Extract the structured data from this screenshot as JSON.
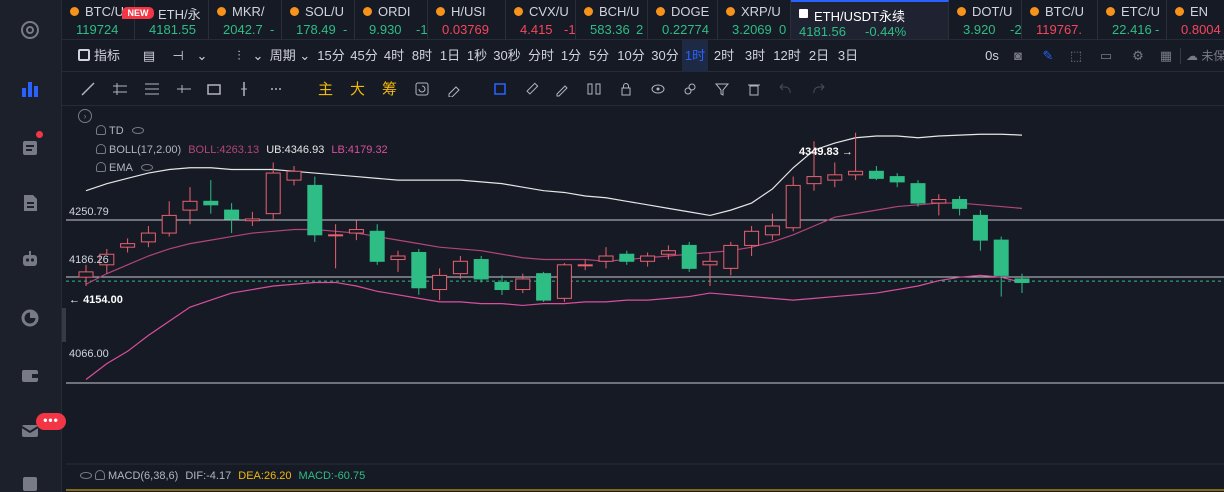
{
  "tickers": [
    {
      "name": "BTC/U",
      "price": "119724",
      "change": "",
      "dir": "up",
      "icon": "btc-coin-icon",
      "active": false
    },
    {
      "name": "ETH/永",
      "price": "4181.55",
      "change": "",
      "dir": "up",
      "icon": "eth-coin-icon",
      "active": false
    },
    {
      "name": "MKR/",
      "price": "2042.7",
      "change": "-",
      "dir": "up",
      "icon": "mkr-coin-icon",
      "active": false
    },
    {
      "name": "SOL/U",
      "price": "178.49",
      "change": "-",
      "dir": "up",
      "icon": "sol-coin-icon",
      "active": false
    },
    {
      "name": "ORDI",
      "price": "9.930",
      "change": "-1",
      "dir": "up",
      "icon": "ordi-coin-icon",
      "active": false
    },
    {
      "name": "H/USI",
      "price": "0.03769",
      "change": "",
      "dir": "down",
      "icon": "h-coin-icon",
      "active": false
    },
    {
      "name": "CVX/U",
      "price": "4.415",
      "change": "-1",
      "dir": "down",
      "icon": "cvx-coin-icon",
      "active": false
    },
    {
      "name": "BCH/U",
      "price": "583.36",
      "change": "2",
      "dir": "up",
      "icon": "bch-coin-icon",
      "active": false
    },
    {
      "name": "DOGE",
      "price": "0.22774",
      "change": "",
      "dir": "up",
      "icon": "doge-coin-icon",
      "active": false
    },
    {
      "name": "XRP/U",
      "price": "3.2069",
      "change": "0",
      "dir": "up",
      "icon": "xrp-coin-icon",
      "active": false
    },
    {
      "name": "ETH/USDT永续",
      "price": "4181.56",
      "change": "-0.44%",
      "dir": "up",
      "icon": "eth-coin-icon",
      "active": true
    },
    {
      "name": "DOT/U",
      "price": "3.920",
      "change": "-2",
      "dir": "up",
      "icon": "dot-coin-icon",
      "active": false
    },
    {
      "name": "BTC/U",
      "price": "119767.",
      "change": "",
      "dir": "down",
      "icon": "btc-coin-icon",
      "active": false
    },
    {
      "name": "ETC/U",
      "price": "22.416",
      "change": "-",
      "dir": "up",
      "icon": "etc-coin-icon",
      "active": false
    },
    {
      "name": "EN",
      "price": "0.8004",
      "change": "",
      "dir": "down",
      "icon": "en-coin-icon",
      "active": false
    }
  ],
  "new_badge": "NEW",
  "toolbar": {
    "indicators_label": "指标",
    "period_label": "周期",
    "intervals": [
      "15分",
      "45分",
      "4时",
      "8时",
      "1日",
      "1秒",
      "30秒",
      "分时",
      "1分",
      "5分",
      "10分",
      "30分",
      "1时",
      "2时",
      "3时",
      "12时",
      "2日",
      "3日"
    ],
    "active_interval": "1时",
    "seconds_label": "0s",
    "cloud_label": "未保"
  },
  "drawing_chars": [
    "主",
    "大",
    "筹"
  ],
  "legend": {
    "td_label": "TD",
    "boll_label": "BOLL(17,2.00)",
    "boll_value": "BOLL:4263.13",
    "ub_value": "UB:4346.93",
    "lb_value": "LB:4179.32",
    "ema_label": "EMA",
    "macd_label": "MACD(6,38,6)",
    "dif_value": "DIF:-4.17",
    "dea_value": "DEA:26.20",
    "macd_value": "MACD:-60.75"
  },
  "price_levels": [
    "4250.79",
    "4186.26",
    "4154.00",
    "4066.00"
  ],
  "high_marker": "4349.83",
  "colors": {
    "up": "#2ebd85",
    "down": "#f6465d",
    "accent": "#2962ff",
    "ub_line": "#e6e6e6",
    "mid_line": "#b2457a",
    "lb_line": "#d94f9e",
    "background": "#161a25"
  },
  "chart_data": {
    "type": "candlestick",
    "symbol": "ETH/USDT永续",
    "interval": "1时",
    "ylim": [
      4040,
      4380
    ],
    "candles": [
      {
        "o": 4186,
        "c": 4192,
        "h": 4200,
        "l": 4176
      },
      {
        "o": 4200,
        "c": 4212,
        "h": 4218,
        "l": 4190
      },
      {
        "o": 4220,
        "c": 4224,
        "h": 4230,
        "l": 4214
      },
      {
        "o": 4226,
        "c": 4236,
        "h": 4244,
        "l": 4220
      },
      {
        "o": 4236,
        "c": 4256,
        "h": 4272,
        "l": 4232
      },
      {
        "o": 4262,
        "c": 4272,
        "h": 4288,
        "l": 4246
      },
      {
        "o": 4272,
        "c": 4268,
        "h": 4296,
        "l": 4258
      },
      {
        "o": 4262,
        "c": 4252,
        "h": 4270,
        "l": 4236
      },
      {
        "o": 4250,
        "c": 4252,
        "h": 4260,
        "l": 4244
      },
      {
        "o": 4258,
        "c": 4304,
        "h": 4316,
        "l": 4250
      },
      {
        "o": 4296,
        "c": 4306,
        "h": 4312,
        "l": 4290
      },
      {
        "o": 4290,
        "c": 4234,
        "h": 4300,
        "l": 4226
      },
      {
        "o": 4233,
        "c": 4234,
        "h": 4246,
        "l": 4196
      },
      {
        "o": 4236,
        "c": 4240,
        "h": 4250,
        "l": 4228
      },
      {
        "o": 4238,
        "c": 4204,
        "h": 4246,
        "l": 4200
      },
      {
        "o": 4206,
        "c": 4210,
        "h": 4216,
        "l": 4192
      },
      {
        "o": 4214,
        "c": 4174,
        "h": 4218,
        "l": 4166
      },
      {
        "o": 4172,
        "c": 4188,
        "h": 4196,
        "l": 4160
      },
      {
        "o": 4190,
        "c": 4204,
        "h": 4210,
        "l": 4184
      },
      {
        "o": 4206,
        "c": 4184,
        "h": 4210,
        "l": 4180
      },
      {
        "o": 4180,
        "c": 4172,
        "h": 4188,
        "l": 4166
      },
      {
        "o": 4172,
        "c": 4184,
        "h": 4190,
        "l": 4168
      },
      {
        "o": 4190,
        "c": 4160,
        "h": 4192,
        "l": 4158
      },
      {
        "o": 4162,
        "c": 4200,
        "h": 4202,
        "l": 4158
      },
      {
        "o": 4200,
        "c": 4200,
        "h": 4206,
        "l": 4194
      },
      {
        "o": 4204,
        "c": 4210,
        "h": 4220,
        "l": 4196
      },
      {
        "o": 4212,
        "c": 4204,
        "h": 4216,
        "l": 4200
      },
      {
        "o": 4204,
        "c": 4210,
        "h": 4214,
        "l": 4198
      },
      {
        "o": 4212,
        "c": 4216,
        "h": 4222,
        "l": 4206
      },
      {
        "o": 4222,
        "c": 4196,
        "h": 4226,
        "l": 4192
      },
      {
        "o": 4200,
        "c": 4204,
        "h": 4214,
        "l": 4176
      },
      {
        "o": 4196,
        "c": 4222,
        "h": 4226,
        "l": 4188
      },
      {
        "o": 4222,
        "c": 4238,
        "h": 4244,
        "l": 4210
      },
      {
        "o": 4234,
        "c": 4244,
        "h": 4258,
        "l": 4228
      },
      {
        "o": 4242,
        "c": 4290,
        "h": 4300,
        "l": 4238
      },
      {
        "o": 4292,
        "c": 4300,
        "h": 4340,
        "l": 4284
      },
      {
        "o": 4296,
        "c": 4302,
        "h": 4316,
        "l": 4288
      },
      {
        "o": 4302,
        "c": 4306,
        "h": 4349.83,
        "l": 4296
      },
      {
        "o": 4306,
        "c": 4298,
        "h": 4312,
        "l": 4296
      },
      {
        "o": 4300,
        "c": 4294,
        "h": 4304,
        "l": 4288
      },
      {
        "o": 4292,
        "c": 4270,
        "h": 4296,
        "l": 4266
      },
      {
        "o": 4270,
        "c": 4274,
        "h": 4280,
        "l": 4256
      },
      {
        "o": 4274,
        "c": 4264,
        "h": 4278,
        "l": 4256
      },
      {
        "o": 4256,
        "c": 4228,
        "h": 4262,
        "l": 4216
      },
      {
        "o": 4228,
        "c": 4188,
        "h": 4232,
        "l": 4164
      },
      {
        "o": 4184,
        "c": 4180,
        "h": 4190,
        "l": 4168
      }
    ],
    "boll_ub": [
      4284,
      4292,
      4298,
      4304,
      4308,
      4310,
      4310,
      4308,
      4308,
      4308,
      4306,
      4304,
      4302,
      4300,
      4298,
      4296,
      4296,
      4296,
      4296,
      4294,
      4292,
      4288,
      4284,
      4282,
      4278,
      4276,
      4272,
      4268,
      4264,
      4260,
      4256,
      4262,
      4270,
      4286,
      4310,
      4330,
      4338,
      4344,
      4346,
      4346,
      4344,
      4346,
      4347,
      4348,
      4348,
      4347
    ],
    "boll_mid": [
      4178,
      4190,
      4200,
      4210,
      4218,
      4224,
      4228,
      4232,
      4236,
      4238,
      4240,
      4240,
      4238,
      4236,
      4232,
      4228,
      4224,
      4220,
      4218,
      4216,
      4212,
      4208,
      4206,
      4206,
      4206,
      4204,
      4206,
      4208,
      4210,
      4212,
      4214,
      4216,
      4220,
      4226,
      4234,
      4244,
      4254,
      4258,
      4262,
      4266,
      4268,
      4270,
      4270,
      4268,
      4266,
      4264
    ],
    "boll_lb": [
      4070,
      4088,
      4102,
      4120,
      4136,
      4152,
      4160,
      4168,
      4172,
      4176,
      4178,
      4180,
      4180,
      4176,
      4170,
      4166,
      4162,
      4158,
      4158,
      4156,
      4156,
      4154,
      4156,
      4156,
      4158,
      4158,
      4160,
      4160,
      4162,
      4164,
      4168,
      4166,
      4164,
      4162,
      4160,
      4162,
      4164,
      4166,
      4168,
      4172,
      4176,
      4182,
      4186,
      4188,
      4186,
      4180
    ]
  }
}
